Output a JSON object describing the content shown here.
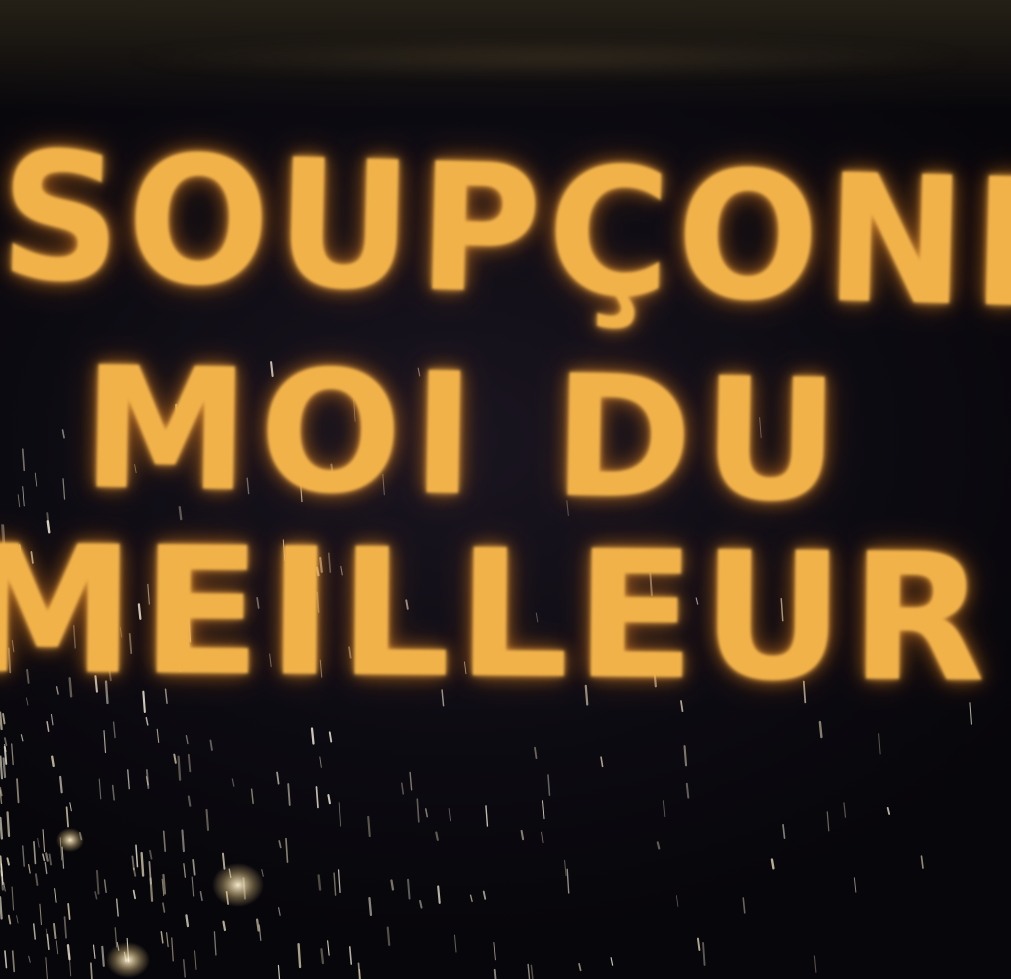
{
  "scene": {
    "description_kind": "stencil-graffiti-photo",
    "background_color": "#0b0a10",
    "text_color": "#f1b24a",
    "glow_color": "#ff9a28"
  },
  "graffiti": {
    "line_1": "SOUPÇONNE",
    "line_2": "MOI DU",
    "line_3": "MEILLEUR"
  }
}
